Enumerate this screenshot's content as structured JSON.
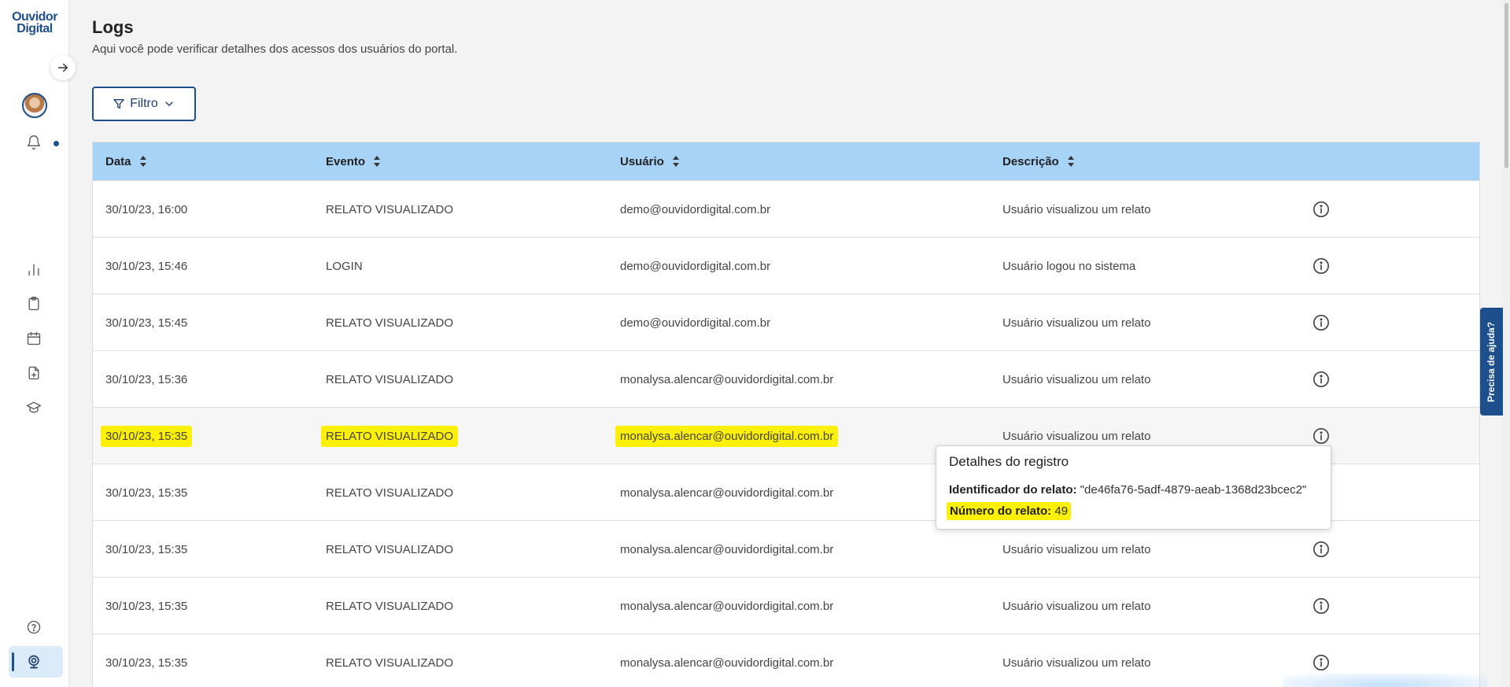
{
  "brand": {
    "logo_line1": "Ouvidor",
    "logo_line2": "Digital"
  },
  "page": {
    "title": "Logs",
    "subtitle": "Aqui você pode verificar detalhes dos acessos dos usuários do portal."
  },
  "filter": {
    "label": "Filtro"
  },
  "table": {
    "columns": [
      "Data",
      "Evento",
      "Usuário",
      "Descrição"
    ],
    "rows": [
      {
        "data": "30/10/23, 16:00",
        "evento": "RELATO VISUALIZADO",
        "usuario": "demo@ouvidordigital.com.br",
        "descricao": "Usuário visualizou um relato"
      },
      {
        "data": "30/10/23, 15:46",
        "evento": "LOGIN",
        "usuario": "demo@ouvidordigital.com.br",
        "descricao": "Usuário logou no sistema"
      },
      {
        "data": "30/10/23, 15:45",
        "evento": "RELATO VISUALIZADO",
        "usuario": "demo@ouvidordigital.com.br",
        "descricao": "Usuário visualizou um relato"
      },
      {
        "data": "30/10/23, 15:36",
        "evento": "RELATO VISUALIZADO",
        "usuario": "monalysa.alencar@ouvidordigital.com.br",
        "descricao": "Usuário visualizou um relato"
      },
      {
        "data": "30/10/23, 15:35",
        "evento": "RELATO VISUALIZADO",
        "usuario": "monalysa.alencar@ouvidordigital.com.br",
        "descricao": "Usuário visualizou um relato"
      },
      {
        "data": "30/10/23, 15:35",
        "evento": "RELATO VISUALIZADO",
        "usuario": "monalysa.alencar@ouvidordigital.com.br",
        "descricao": ""
      },
      {
        "data": "30/10/23, 15:35",
        "evento": "RELATO VISUALIZADO",
        "usuario": "monalysa.alencar@ouvidordigital.com.br",
        "descricao": "Usuário visualizou um relato"
      },
      {
        "data": "30/10/23, 15:35",
        "evento": "RELATO VISUALIZADO",
        "usuario": "monalysa.alencar@ouvidordigital.com.br",
        "descricao": "Usuário visualizou um relato"
      },
      {
        "data": "30/10/23, 15:35",
        "evento": "RELATO VISUALIZADO",
        "usuario": "monalysa.alencar@ouvidordigital.com.br",
        "descricao": "Usuário visualizou um relato"
      }
    ]
  },
  "tooltip": {
    "title": "Detalhes do registro",
    "id_label": "Identificador do relato:",
    "id_value": "\"de46fa76-5adf-4879-aeab-1368d23bcec2\"",
    "number_label": "Número do relato:",
    "number_value": "49"
  },
  "help": {
    "label": "Precisa de ajuda?"
  },
  "colors": {
    "primary": "#1d4f8c",
    "header_bg": "#a7d3f7",
    "highlight": "#fbf006"
  },
  "icons": {
    "sidebar": [
      "arrow-right-icon",
      "bell-icon",
      "bar-chart-icon",
      "clipboard-icon",
      "calendar-icon",
      "file-plus-icon",
      "graduation-cap-icon",
      "help-circle-icon",
      "webcam-icon"
    ],
    "table": [
      "sort-icon",
      "info-icon"
    ],
    "filter": [
      "filter-icon",
      "chevron-down-icon"
    ]
  }
}
